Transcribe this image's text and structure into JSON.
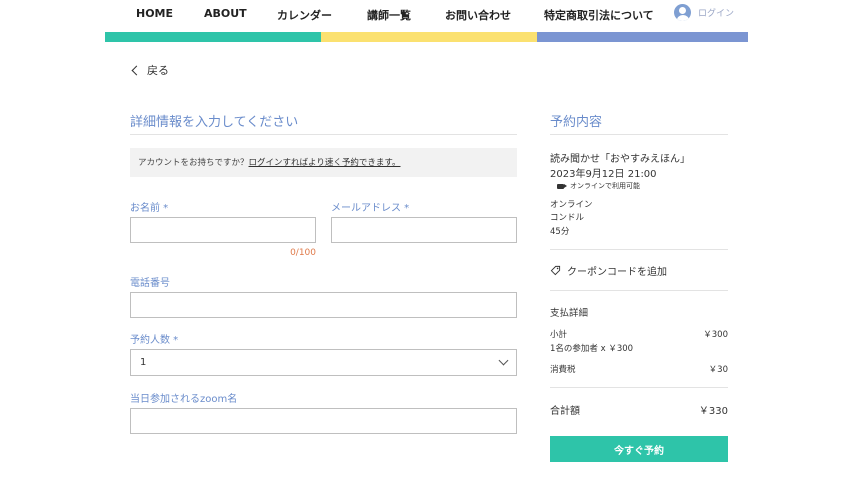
{
  "nav": {
    "home": "HOME",
    "about": "ABOUT",
    "calendar": "カレンダー",
    "teachers": "講師一覧",
    "contact": "お問い合わせ",
    "legal": "特定商取引法について",
    "login": "ログイン"
  },
  "colors": {
    "teal": "#2ec4a9",
    "yellow": "#fbe170",
    "blue": "#7b95d2",
    "accent_text": "#6a8ccb",
    "counter": "#e07a4a"
  },
  "back_label": "戻る",
  "form": {
    "title": "詳細情報を入力してください",
    "notice_text": "アカウントをお持ちですか？",
    "notice_link": "ログインすればより速く予約できます。",
    "name_label": "お名前 *",
    "name_value": "",
    "name_counter": "0/100",
    "email_label": "メールアドレス *",
    "email_value": "",
    "phone_label": "電話番号",
    "phone_value": "",
    "people_label": "予約人数 *",
    "people_value": "1",
    "zoom_label": "当日参加されるzoom名",
    "zoom_value": ""
  },
  "summary": {
    "title": "予約内容",
    "event_name": "読み聞かせ「おやすみえほん」",
    "datetime": "2023年9月12日 21:00",
    "online_badge": "オンラインで利用可能",
    "location": "オンライン",
    "instructor": "コンドル",
    "duration": "45分",
    "coupon_label": "クーポンコードを追加",
    "payment_title": "支払詳細",
    "subtotal_label": "小計",
    "subtotal_value": "￥300",
    "participants_detail": "1名の参加者 x ￥300",
    "tax_label": "消費税",
    "tax_value": "￥30",
    "total_label": "合計額",
    "total_value": "￥330",
    "book_button": "今すぐ予約"
  },
  "icons": {
    "avatar": "user-avatar-icon",
    "back": "chevron-left-icon",
    "dropdown": "chevron-down-icon",
    "video": "video-camera-icon",
    "coupon": "tag-icon"
  }
}
